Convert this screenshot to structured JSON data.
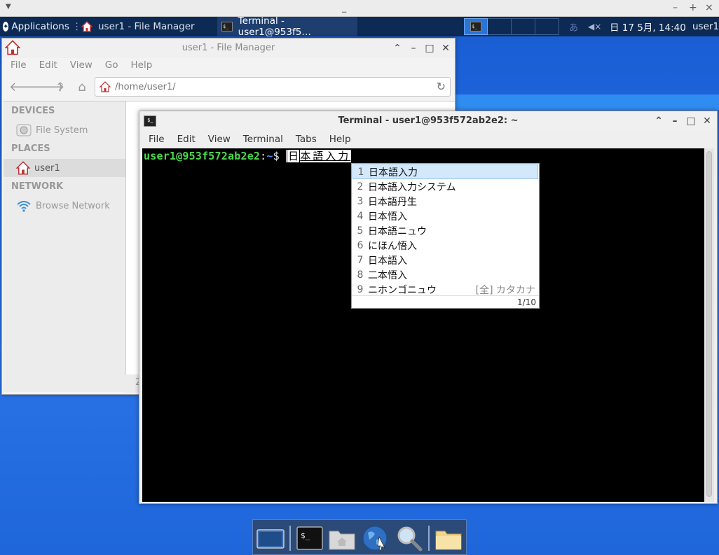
{
  "panel": {
    "applications_label": "Applications",
    "tasks": [
      {
        "label": "user1 - File Manager",
        "icon": "home-icon"
      },
      {
        "label": "Terminal - user1@953f5…",
        "icon": "terminal-icon"
      }
    ],
    "ime_indicator": "あ",
    "volume_icon": "volume-muted-icon",
    "clock": "日 17  5月, 14:40",
    "user": "user1"
  },
  "file_manager": {
    "title": "user1 - File Manager",
    "menu": [
      "File",
      "Edit",
      "View",
      "Go",
      "Help"
    ],
    "path": "/home/user1/",
    "sidebar": {
      "devices_header": "DEVICES",
      "devices": [
        {
          "label": "File System",
          "icon": "drive-icon"
        }
      ],
      "places_header": "PLACES",
      "places": [
        {
          "label": "user1",
          "icon": "home-icon"
        }
      ],
      "network_header": "NETWORK",
      "network": [
        {
          "label": "Browse Network",
          "icon": "wifi-icon"
        }
      ]
    },
    "status_fragment": "2"
  },
  "terminal": {
    "title": "Terminal - user1@953f572ab2e2: ~",
    "menu": [
      "File",
      "Edit",
      "View",
      "Terminal",
      "Tabs",
      "Help"
    ],
    "prompt_user": "user1@953f572ab2e2",
    "prompt_colon": ":",
    "prompt_path": "~",
    "prompt_dollar": "$",
    "preedit_cursor": "日",
    "preedit_rest": "本語入力"
  },
  "candidates": {
    "items": [
      {
        "num": "1",
        "text": "日本語入力",
        "annotation": ""
      },
      {
        "num": "2",
        "text": "日本語入力システム",
        "annotation": ""
      },
      {
        "num": "3",
        "text": "日本語丹生",
        "annotation": ""
      },
      {
        "num": "4",
        "text": "日本悟入",
        "annotation": ""
      },
      {
        "num": "5",
        "text": "日本語ニュウ",
        "annotation": ""
      },
      {
        "num": "6",
        "text": "にほん悟入",
        "annotation": ""
      },
      {
        "num": "7",
        "text": "日本語入",
        "annotation": ""
      },
      {
        "num": "8",
        "text": "二本悟入",
        "annotation": ""
      },
      {
        "num": "9",
        "text": "ニホンゴニュウ",
        "annotation": "[全] カタカナ"
      }
    ],
    "selected_index": 0,
    "page_indicator": "1/10"
  },
  "dock": {
    "items": [
      "show-desktop-icon",
      "terminal-icon",
      "home-folder-icon",
      "web-browser-icon",
      "search-icon",
      "folder-icon"
    ]
  },
  "colors": {
    "desktop": "#1e64d6",
    "panel": "#0d2a55",
    "prompt_user": "#4bd94b",
    "prompt_path": "#4b8bff",
    "candidate_selected": "#d3e8fb"
  }
}
